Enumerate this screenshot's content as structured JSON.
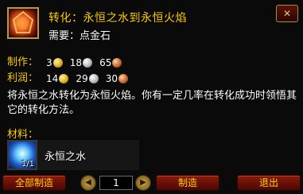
{
  "recipe": {
    "icon": "eternal-fire-icon",
    "title": "转化：永恒之水到永恒火焰",
    "requires": "需要：点金石"
  },
  "cost": {
    "make_label": "制作：",
    "make_gold": "3",
    "make_silver": "18",
    "make_copper": "65",
    "profit_label": "利润：",
    "profit_gold": "14",
    "profit_silver": "29",
    "profit_copper": "30"
  },
  "description": "将永恒之水转化为永恒火焰。你有一定几率在转化成功时领悟其它的转化方法。",
  "materials": {
    "label": "材料：",
    "items": [
      {
        "name": "永恒之水",
        "count": "1/1",
        "icon": "eternal-water-icon"
      }
    ]
  },
  "controls": {
    "create_all": "全部制造",
    "quantity": "1",
    "create": "制造",
    "exit": "退出",
    "decrement_icon": "arrow-left-icon",
    "increment_icon": "arrow-right-icon",
    "close_icon": "close-icon"
  },
  "colors": {
    "title": "#ffd100",
    "text": "#ffffff",
    "button": "#8a1a0a"
  }
}
